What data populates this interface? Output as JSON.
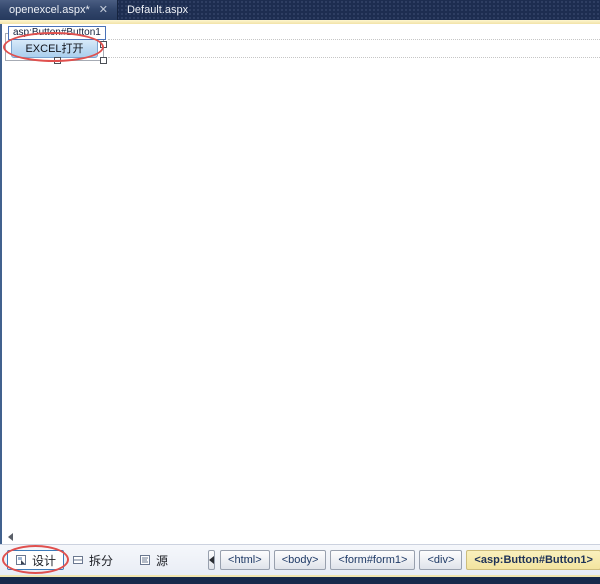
{
  "tabs": {
    "active": {
      "label": "openexcel.aspx*",
      "close_glyph": "✕"
    },
    "inactive": {
      "label": "Default.aspx"
    }
  },
  "designer": {
    "control_tag_label": "asp:Button#Button1",
    "button_label": "EXCEL打开"
  },
  "bottom": {
    "view_buttons": [
      {
        "label": "设计",
        "active": true
      },
      {
        "label": "拆分",
        "active": false
      },
      {
        "label": "源",
        "active": false
      }
    ],
    "breadcrumbs": [
      {
        "label": "<html>"
      },
      {
        "label": "<body>"
      },
      {
        "label": "<form#form1>"
      },
      {
        "label": "<div>"
      },
      {
        "label": "<asp:Button#Button1>",
        "highlighted": true
      }
    ]
  },
  "colors": {
    "tabbar_navy": "#1d2d50",
    "accent_cream": "#f7ecbe",
    "annotation_red": "#e0504e",
    "selection_border_blue": "#3d7ab8",
    "highlight_yellow": "#f3e49f"
  }
}
